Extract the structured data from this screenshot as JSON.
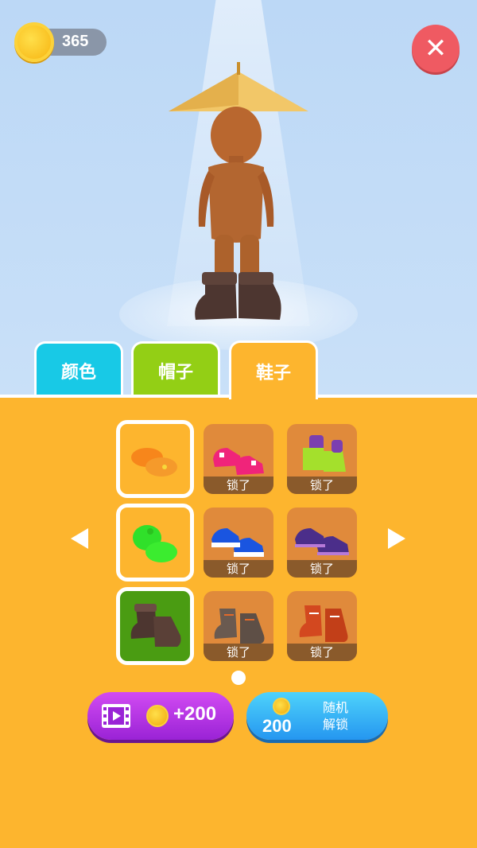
{
  "currency": {
    "coins": "365",
    "icon": "gold-coin-icon"
  },
  "close": {
    "icon": "close-icon",
    "glyph": "✕",
    "color": "#ef5a62"
  },
  "tabs": [
    {
      "label": "颜色",
      "color": "#18c9e6"
    },
    {
      "label": "帽子",
      "color": "#93cf15"
    },
    {
      "label": "鞋子",
      "color": "#fdb52e",
      "active": true
    }
  ],
  "grid": {
    "cells": [
      {
        "name": "orange-clogs",
        "locked": false,
        "selected": false,
        "color": "#f7861b"
      },
      {
        "name": "pink-sneakers",
        "locked": true,
        "lock_label": "锁了",
        "color": "#f0247a"
      },
      {
        "name": "lime-boots",
        "locked": true,
        "lock_label": "锁了",
        "color": "#a4e02c"
      },
      {
        "name": "green-clogs",
        "locked": false,
        "selected": false,
        "color": "#30e02a"
      },
      {
        "name": "blue-sneakers",
        "locked": true,
        "lock_label": "锁了",
        "color": "#1a55e0"
      },
      {
        "name": "purple-sneakers",
        "locked": true,
        "lock_label": "锁了",
        "color": "#4b2e8a"
      },
      {
        "name": "brown-boots",
        "locked": false,
        "selected": true,
        "color": "#5a4037"
      },
      {
        "name": "grey-hiking-boots",
        "locked": true,
        "lock_label": "锁了",
        "color": "#6a5a50"
      },
      {
        "name": "red-hiking-boots",
        "locked": true,
        "lock_label": "锁了",
        "color": "#d3481f"
      }
    ]
  },
  "pagination": {
    "page": 1,
    "pages": 1
  },
  "actions": {
    "video_reward": {
      "amount": "+200",
      "icon": "video-film-icon"
    },
    "random_unlock": {
      "price": "200",
      "label_line1": "随机",
      "label_line2": "解锁"
    }
  }
}
